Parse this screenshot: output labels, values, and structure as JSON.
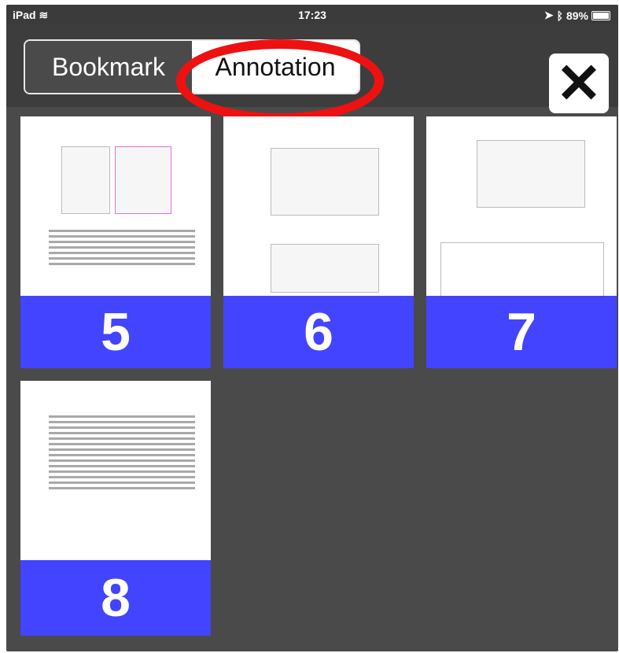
{
  "status_bar": {
    "device": "iPad",
    "time": "17:23",
    "battery": "89%",
    "battery_level": 0.89
  },
  "tabs": {
    "bookmark_label": "Bookmark",
    "annotation_label": "Annotation",
    "selected": "annotation"
  },
  "close_label": "✕",
  "pages": [
    {
      "number": "5",
      "label": "5"
    },
    {
      "number": "6",
      "label": "6"
    },
    {
      "number": "7",
      "label": "7"
    },
    {
      "number": "8",
      "label": "8"
    }
  ],
  "colors": {
    "highlight_band": "#2f30ff",
    "callout_ring": "#ee1111",
    "background": "#4a4a4a"
  },
  "icons": [
    "wifi-icon",
    "location-arrow-icon",
    "bluetooth-icon",
    "battery-icon",
    "close-icon"
  ]
}
